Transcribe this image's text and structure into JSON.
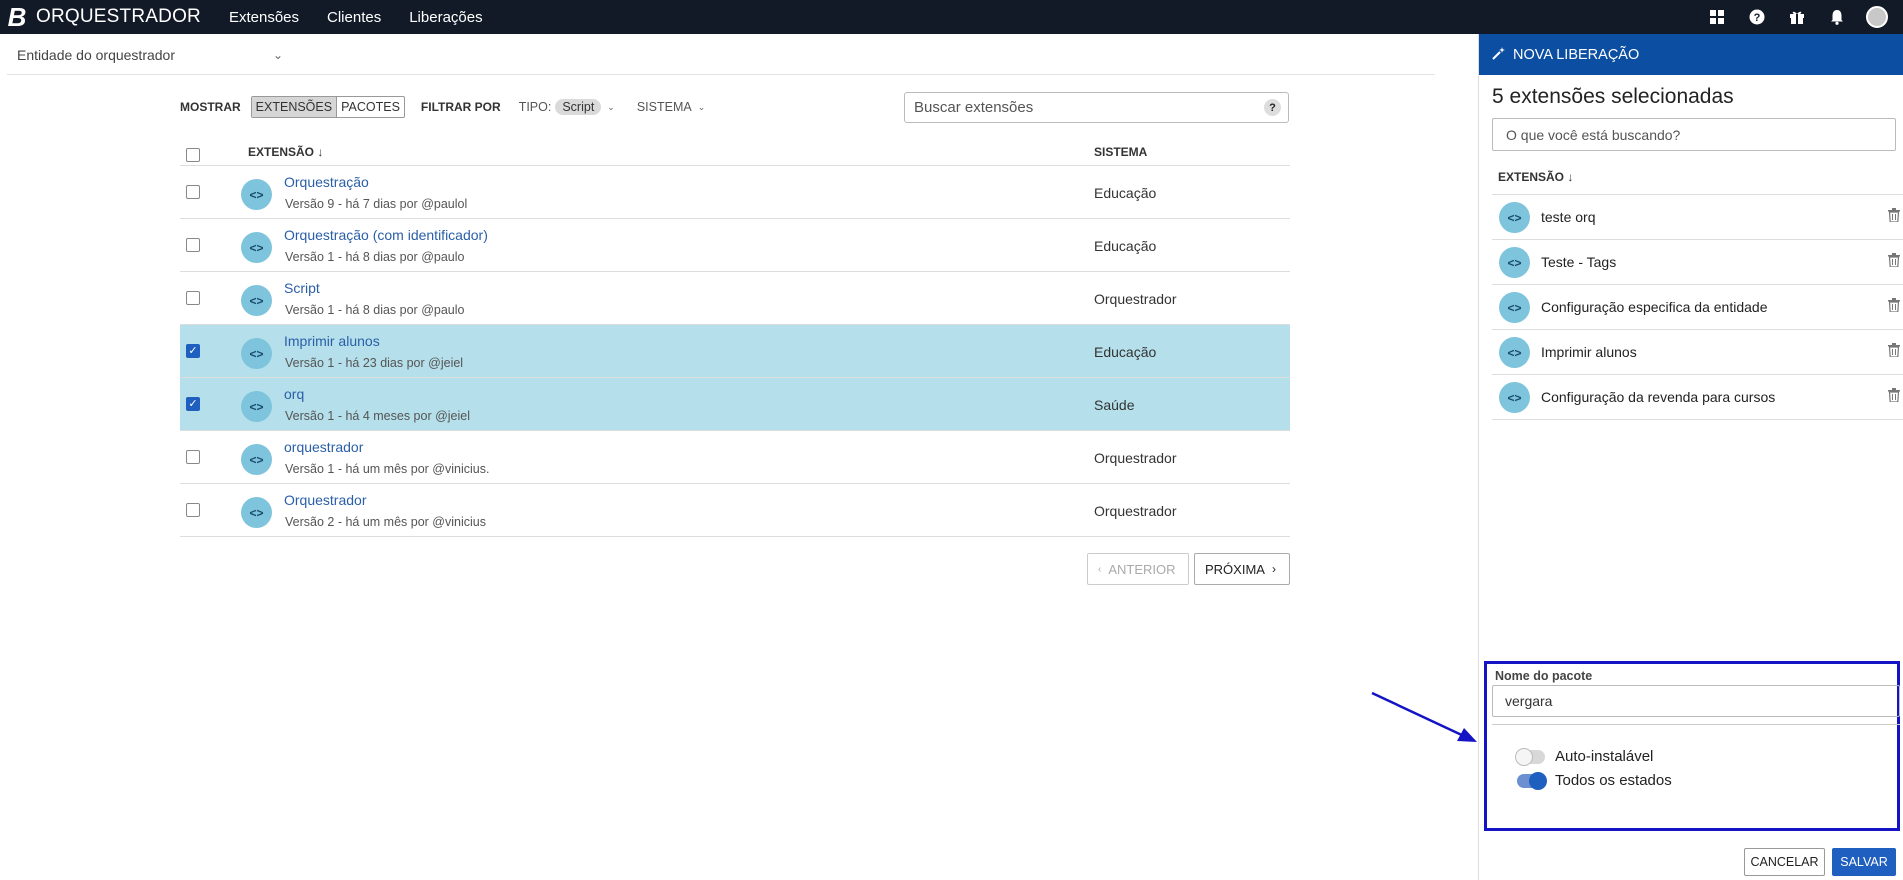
{
  "topbar": {
    "logo": "B",
    "brand": "ORQUESTRADOR",
    "nav": [
      "Extensões",
      "Clientes",
      "Liberações"
    ],
    "icons": [
      "apps-grid-icon",
      "help-icon",
      "gift-icon",
      "bell-icon",
      "user-avatar"
    ]
  },
  "entity": {
    "label": "Entidade do orquestrador"
  },
  "filters": {
    "show_label": "MOSTRAR",
    "show_options": [
      "EXTENSÕES",
      "PACOTES"
    ],
    "show_selected": "EXTENSÕES",
    "filter_label": "FILTRAR POR",
    "tipo_label": "TIPO:",
    "tipo_value": "Script",
    "sistema_label": "SISTEMA",
    "search_placeholder": "Buscar extensões",
    "help": "?"
  },
  "table": {
    "columns": [
      "EXTENSÃO",
      "SISTEMA"
    ],
    "rows": [
      {
        "name": "Orquestração",
        "version": "Versão 9 - há 7 dias por @paulol",
        "system": "Educação",
        "checked": false
      },
      {
        "name": "Orquestração (com identificador)",
        "version": "Versão 1 - há 8 dias por @paulo",
        "system": "Educação",
        "checked": false
      },
      {
        "name": "Script",
        "version": "Versão 1 - há 8 dias por @paulo",
        "system": "Orquestrador",
        "checked": false
      },
      {
        "name": "Imprimir alunos",
        "version": "Versão 1 - há 23 dias por @jeiel",
        "system": "Educação",
        "checked": true
      },
      {
        "name": "orq",
        "version": "Versão 1 - há 4 meses por @jeiel",
        "system": "Saúde",
        "checked": true
      },
      {
        "name": "orquestrador",
        "version": "Versão 1 - há um mês por @vinicius.",
        "system": "Orquestrador",
        "checked": false
      },
      {
        "name": "Orquestrador",
        "version": "Versão 2 - há um mês por @vinicius",
        "system": "Orquestrador",
        "checked": false
      }
    ],
    "ext_icon_glyph": "<>"
  },
  "pager": {
    "prev": "ANTERIOR",
    "next": "PRÓXIMA"
  },
  "panel": {
    "title": "NOVA LIBERAÇÃO",
    "selected_count": "5 extensões selecionadas",
    "search_placeholder": "O que você está buscando?",
    "column": "EXTENSÃO",
    "items": [
      "teste orq",
      "Teste - Tags",
      "Configuração especifica da entidade",
      "Imprimir alunos",
      "Configuração da revenda para cursos"
    ],
    "form": {
      "package_label": "Nome do pacote",
      "package_value": "vergara",
      "toggle_auto": {
        "label": "Auto-instalável",
        "on": false
      },
      "toggle_all_states": {
        "label": "Todos os estados",
        "on": true
      }
    },
    "cancel": "CANCELAR",
    "save": "SALVAR"
  },
  "colors": {
    "topbar": "#121a27",
    "panel_header": "#0b4ea2",
    "selected_row": "#b5dfea",
    "link": "#2a5fa8",
    "primary": "#1f5fbf",
    "annotation": "#1414c4"
  }
}
